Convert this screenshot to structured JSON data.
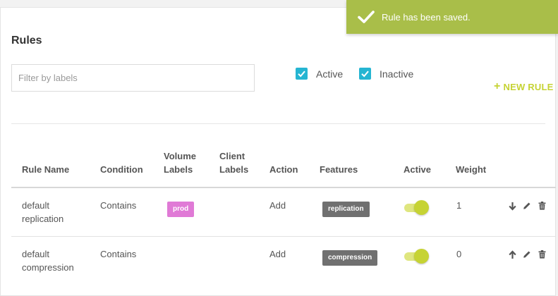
{
  "page": {
    "title": "Rules",
    "filter": {
      "placeholder": "Filter by labels",
      "value": ""
    },
    "filters": [
      {
        "label": "Active",
        "checked": true
      },
      {
        "label": "Inactive",
        "checked": true
      }
    ],
    "new_rule_label": "NEW RULE"
  },
  "table": {
    "columns": {
      "rule_name": "Rule Name",
      "condition": "Condition",
      "volume_labels_1": "Volume",
      "volume_labels_2": "Labels",
      "client_labels_1": "Client",
      "client_labels_2": "Labels",
      "action": "Action",
      "features": "Features",
      "active": "Active",
      "weight": "Weight"
    },
    "rows": [
      {
        "name_line1": "default",
        "name_line2": "replication",
        "condition": "Contains",
        "volume_label": "prod",
        "client_labels": "",
        "action": "Add",
        "feature": "replication",
        "active": true,
        "weight": "1",
        "move_icon": "arrow-down-icon"
      },
      {
        "name_line1": "default",
        "name_line2": "compression",
        "condition": "Contains",
        "volume_label": "",
        "client_labels": "",
        "action": "Add",
        "feature": "compression",
        "active": true,
        "weight": "0",
        "move_icon": "arrow-up-icon"
      }
    ]
  },
  "toast": {
    "message": "Rule has been saved.",
    "icon": "check-icon"
  },
  "colors": {
    "accent": "#c6d334",
    "checkbox": "#25b5d2",
    "toast_bg": "#a9be49",
    "prod_tag": "#e07ad6",
    "feature_tag": "#707070"
  }
}
